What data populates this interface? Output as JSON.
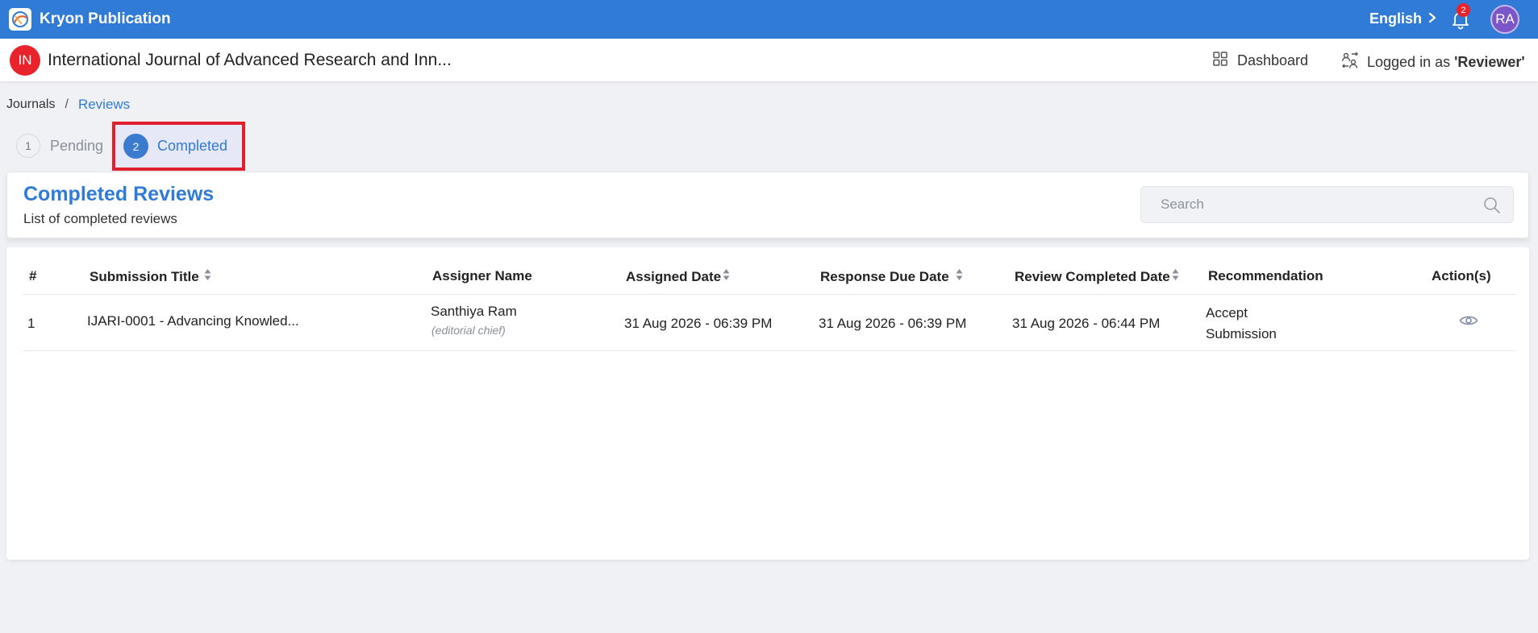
{
  "app": {
    "name": "Kryon Publication",
    "language": "English",
    "notification_count": "2",
    "user_initials": "RA"
  },
  "journal": {
    "badge": "IN",
    "title": "International Journal of Advanced Research and Inn...",
    "dashboard_label": "Dashboard",
    "logged_in_prefix": "Logged in as",
    "role": "'Reviewer'"
  },
  "breadcrumb": {
    "journals": "Journals",
    "separator": "/",
    "reviews": "Reviews"
  },
  "tabs": [
    {
      "number": "1",
      "label": "Pending",
      "active": false
    },
    {
      "number": "2",
      "label": "Completed",
      "active": true
    }
  ],
  "section": {
    "title": "Completed Reviews",
    "subtitle": "List of completed reviews",
    "search_placeholder": "Search"
  },
  "table": {
    "columns": [
      "#",
      "Submission Title",
      "Assigner Name",
      "Assigned Date",
      "Response Due Date",
      "Review Completed Date",
      "Recommendation",
      "Action(s)"
    ],
    "rows": [
      {
        "index": "1",
        "submission_title": "IJARI-0001 - Advancing Knowled...",
        "assigner_name": "Santhiya Ram",
        "assigner_role": "(editorial chief)",
        "assigned_date": "31 Aug 2026 - 06:39 PM",
        "response_due_date": "31 Aug 2026 - 06:39 PM",
        "review_completed_date": "31 Aug 2026 - 06:44 PM",
        "recommendation_line1": "Accept",
        "recommendation_line2": "Submission",
        "action_icon": "eye-icon"
      }
    ]
  },
  "colors": {
    "primary": "#2f7bd6",
    "highlight_border": "#e0202c",
    "badge_red": "#e8232b",
    "avatar_purple": "#7a56c8"
  }
}
